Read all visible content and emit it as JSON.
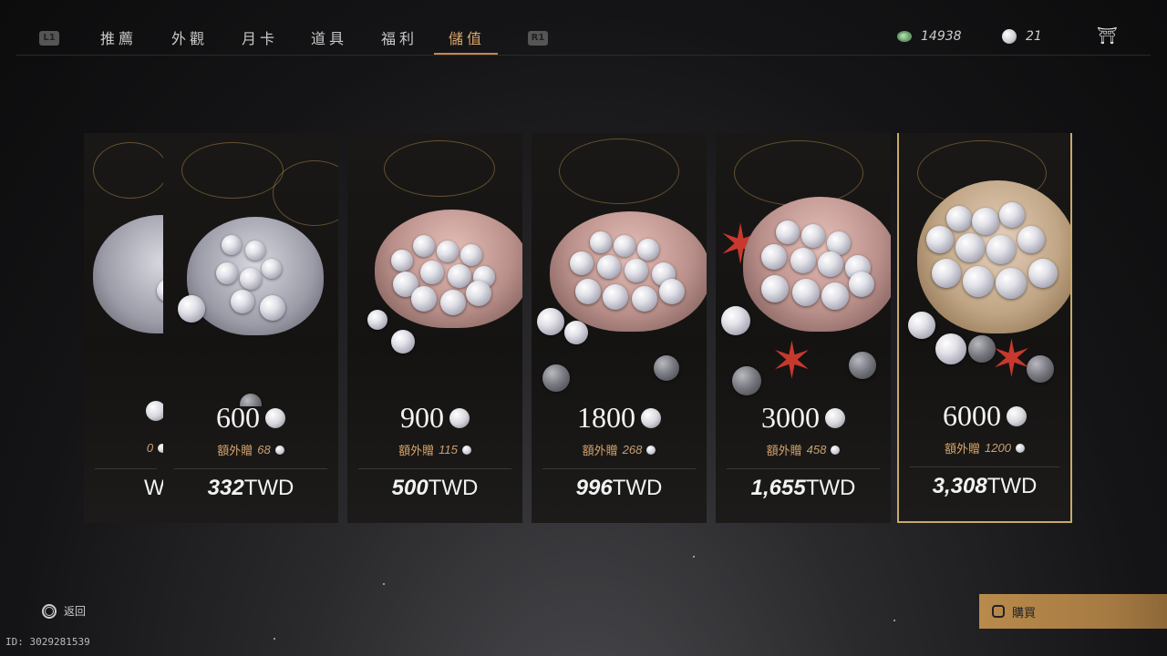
{
  "nav": {
    "left_hint": "L1",
    "right_hint": "R1",
    "tabs": [
      {
        "label": "推薦",
        "active": false
      },
      {
        "label": "外觀",
        "active": false
      },
      {
        "label": "月卡",
        "active": false
      },
      {
        "label": "道具",
        "active": false
      },
      {
        "label": "福利",
        "active": false
      },
      {
        "label": "儲值",
        "active": true
      }
    ]
  },
  "currency": {
    "jade_amount": "14938",
    "pearl_amount": "21",
    "jade_icon": "jade-coin-icon",
    "pearl_icon": "pearl-icon",
    "shop_icon": "shop-icon"
  },
  "bonus_label": "額外贈",
  "currency_unit": "TWD",
  "packages": [
    {
      "amount": "",
      "bonus": "0",
      "price": "",
      "selected": false,
      "partial": true
    },
    {
      "amount": "600",
      "bonus": "68",
      "price": "332",
      "selected": false
    },
    {
      "amount": "900",
      "bonus": "115",
      "price": "500",
      "selected": false
    },
    {
      "amount": "1800",
      "bonus": "268",
      "price": "996",
      "selected": false
    },
    {
      "amount": "3000",
      "bonus": "458",
      "price": "1,655",
      "selected": false
    },
    {
      "amount": "6000",
      "bonus": "1200",
      "price": "3,308",
      "selected": true
    }
  ],
  "footer": {
    "back_label": "返回",
    "buy_label": "購買",
    "user_id": "ID: 3029281539"
  },
  "colors": {
    "accent": "#d9a46a",
    "selected_border": "#c9a96a",
    "buy_button": "#b98a4c"
  }
}
